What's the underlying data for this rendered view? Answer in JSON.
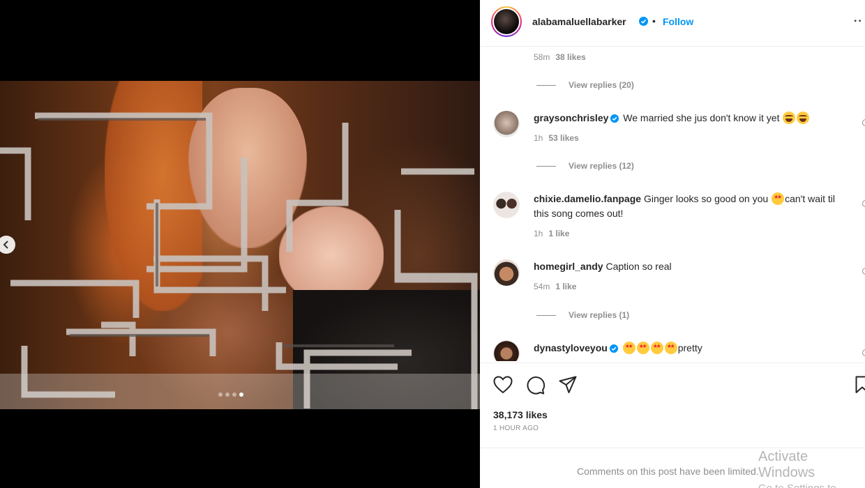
{
  "post": {
    "username": "alabamaluellabarker",
    "separator": "•",
    "follow_label": "Follow",
    "more_label": "··"
  },
  "comments": {
    "top_meta": {
      "time": "58m",
      "likes": "38 likes"
    },
    "top_replies": "View replies (20)",
    "items": [
      {
        "user": "graysonchrisley",
        "verified": true,
        "text": "We married she jus don't know it yet",
        "emojis": [
          "laugh",
          "laugh"
        ],
        "time": "1h",
        "likes": "53 likes",
        "replies": "View replies (12)"
      },
      {
        "user": "chixie.damelio.fanpage",
        "verified": false,
        "text_before": "Ginger looks so good on you",
        "text_after": "can't wait til this song comes out!",
        "emojis": [
          "star"
        ],
        "time": "1h",
        "likes": "1 like"
      },
      {
        "user": "homegirl_andy",
        "verified": false,
        "text": "Caption so real",
        "time": "54m",
        "likes": "1 like",
        "replies": "View replies (1)"
      },
      {
        "user": "dynastyloveyou",
        "verified": true,
        "text": "pretty",
        "emojis": [
          "star",
          "star",
          "star",
          "star"
        ]
      }
    ]
  },
  "footer": {
    "likes": "38,173 likes",
    "time_ago": "1 HOUR AGO",
    "limited_notice": "Comments on this post have been limited."
  },
  "carousel": {
    "dots": 4,
    "active_index": 3
  },
  "watermark": {
    "line1": "Activate Windows",
    "line2": "Go to Settings to activate Windows."
  },
  "colors": {
    "link": "#0095f6",
    "text": "#262626",
    "muted": "#8e8e8e",
    "verified": "#0095f6"
  }
}
